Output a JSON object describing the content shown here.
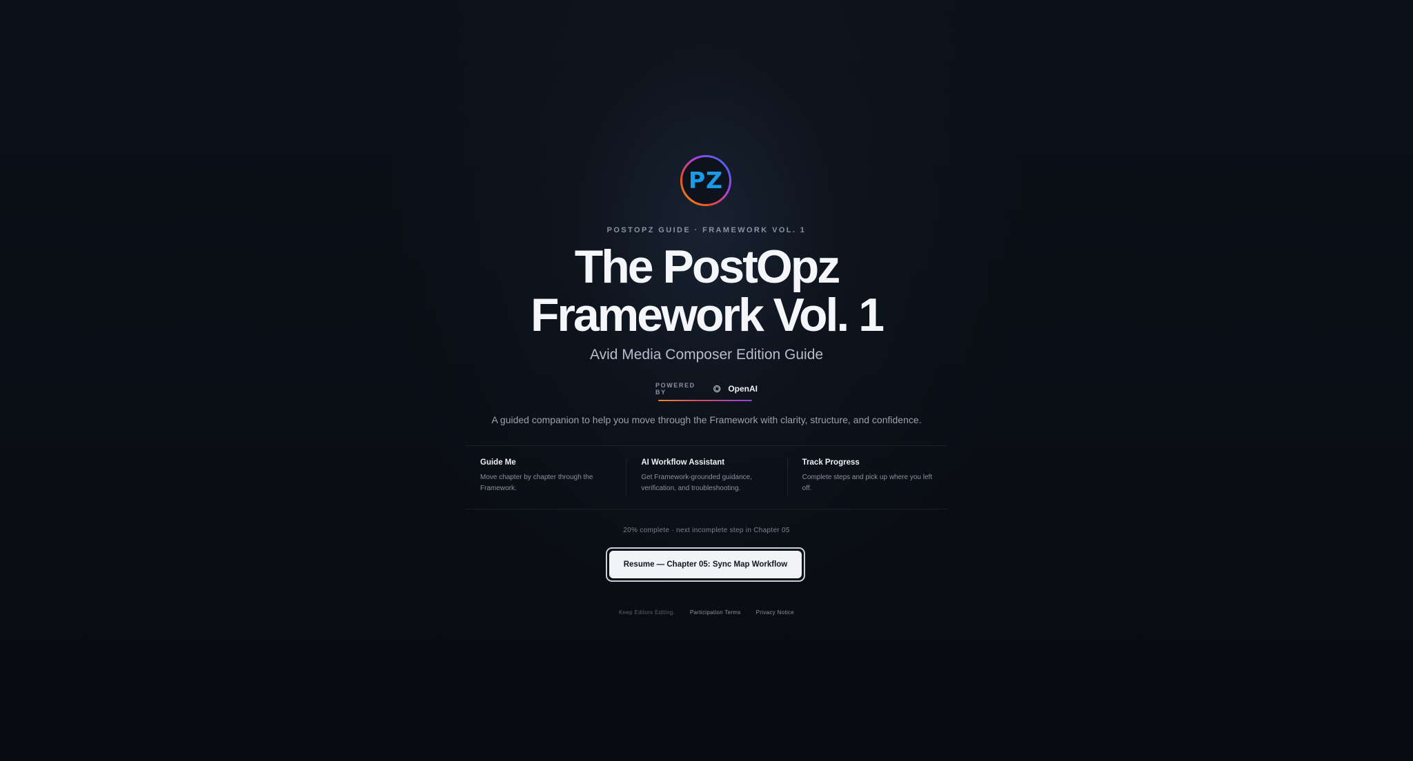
{
  "logo": {
    "text": "PZ",
    "ring_colors": [
      "#e94a2b",
      "#f59e0b",
      "#8b5cf6",
      "#3b82f6",
      "#1d9bf0"
    ],
    "text_color": "#1a9be8"
  },
  "hero": {
    "eyebrow": "POSTOPZ GUIDE · FRAMEWORK VOL. 1",
    "title_line1": "The PostOpz",
    "title_line2": "Framework Vol. 1",
    "subtitle": "Avid Media Composer Edition Guide"
  },
  "powered_by": {
    "label": "POWERED BY",
    "icon": "openai-icon",
    "name": "OpenAI",
    "underline_colors": [
      "#f08a2a",
      "#e0485f",
      "#9046e6"
    ]
  },
  "description": "A guided companion to help you move through the Framework with clarity, structure, and confidence.",
  "features": [
    {
      "title": "Guide Me",
      "description": "Move chapter by chapter through the Framework."
    },
    {
      "title": "AI Workflow Assistant",
      "description": "Get Framework-grounded guidance, verification, and troubleshooting."
    },
    {
      "title": "Track Progress",
      "description": "Complete steps and pick up where you left off."
    }
  ],
  "progress": {
    "percent_complete": 20,
    "text": "20% complete · next incomplete step in Chapter 05"
  },
  "resume_button": {
    "label": "Resume — Chapter 05: Sync Map Workflow"
  },
  "footer": {
    "tagline": "Keep Editors Editing.",
    "links": [
      "Participation Terms",
      "Privacy Notice"
    ]
  },
  "colors": {
    "background": "#090c12",
    "button_bg": "#f1f3f6",
    "button_text": "#111620"
  }
}
